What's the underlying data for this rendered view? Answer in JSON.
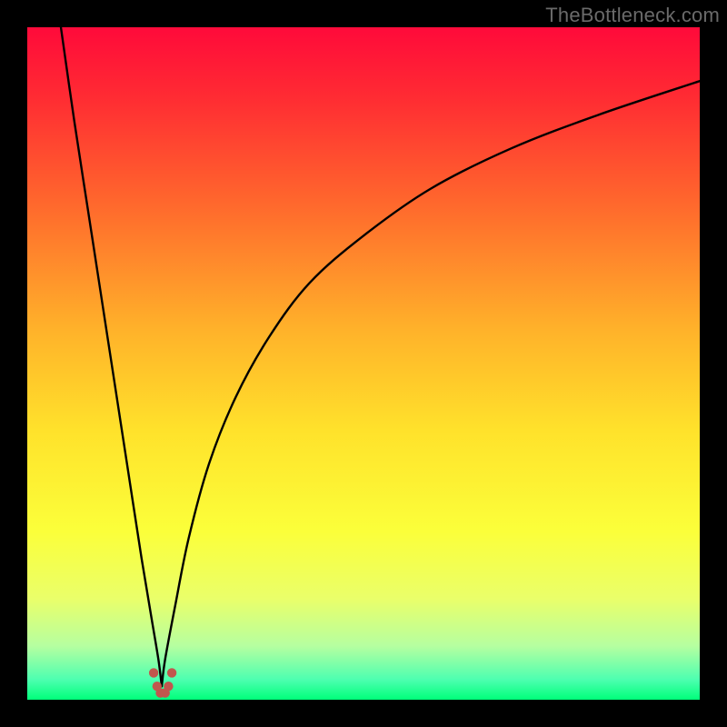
{
  "attribution": "TheBottleneck.com",
  "chart_data": {
    "type": "line",
    "title": "",
    "xlabel": "",
    "ylabel": "",
    "xlim": [
      0,
      100
    ],
    "ylim": [
      0,
      100
    ],
    "grid": false,
    "background_gradient": {
      "direction": "vertical",
      "stops": [
        {
          "pos": 0.0,
          "color": "#ff0a3a"
        },
        {
          "pos": 0.1,
          "color": "#ff2a33"
        },
        {
          "pos": 0.25,
          "color": "#ff632d"
        },
        {
          "pos": 0.45,
          "color": "#ffb22a"
        },
        {
          "pos": 0.6,
          "color": "#ffe22b"
        },
        {
          "pos": 0.75,
          "color": "#fbff3a"
        },
        {
          "pos": 0.85,
          "color": "#eaff6a"
        },
        {
          "pos": 0.92,
          "color": "#b6ffa0"
        },
        {
          "pos": 0.97,
          "color": "#4dffb0"
        },
        {
          "pos": 1.0,
          "color": "#00ff7a"
        }
      ]
    },
    "cusp_x": 20,
    "series": [
      {
        "name": "left-branch",
        "x": [
          5,
          7,
          9,
          11,
          13,
          15,
          17,
          18.5,
          19.5,
          20
        ],
        "y": [
          100,
          86,
          73,
          60,
          47,
          34,
          21,
          12,
          6,
          2
        ]
      },
      {
        "name": "right-branch",
        "x": [
          20,
          20.5,
          22,
          24,
          27,
          31,
          36,
          42,
          50,
          60,
          72,
          85,
          100
        ],
        "y": [
          2,
          6,
          14,
          24,
          35,
          45,
          54,
          62,
          69,
          76,
          82,
          87,
          92
        ]
      }
    ],
    "marker_cluster": {
      "color": "#c1564e",
      "points": [
        {
          "x": 18.8,
          "y": 4.0
        },
        {
          "x": 19.3,
          "y": 2.0
        },
        {
          "x": 19.8,
          "y": 1.0
        },
        {
          "x": 20.5,
          "y": 1.0
        },
        {
          "x": 21.0,
          "y": 2.0
        },
        {
          "x": 21.5,
          "y": 4.0
        }
      ],
      "radius": 5.2
    }
  }
}
